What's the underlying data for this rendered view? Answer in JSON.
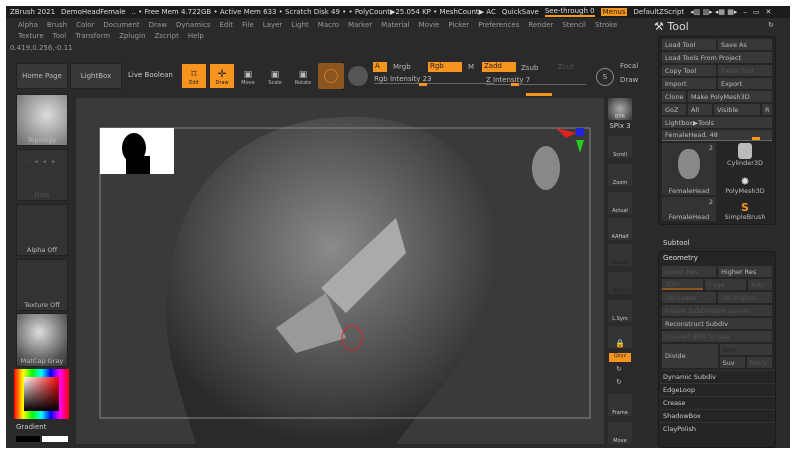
{
  "titlebar": {
    "app": "ZBrush 2021",
    "doc": "DemoHeadFemale",
    "stats": ".. • Free Mem 4.722GB • Active Mem 633 • Scratch Disk 49 • • PolyCount▶25.054 KP • MeshCount▶ AC",
    "quicksave": "QuickSave",
    "seethrough": "See-through  0",
    "menus": "Menus",
    "script": "DefaultZScript"
  },
  "menu": [
    "Alpha",
    "Brush",
    "Color",
    "Document",
    "Draw",
    "Dynamics",
    "Edit",
    "File",
    "Layer",
    "Light",
    "Macro",
    "Marker",
    "Material",
    "Movie",
    "Picker",
    "Preferences",
    "Render",
    "Stencil",
    "Stroke",
    "Texture",
    "Tool",
    "Transform",
    "Zplugin",
    "Zscript",
    "Help"
  ],
  "coords": "0.419,0.256,-0.11",
  "toolbar": {
    "home": "Home Page",
    "lightbox": "LightBox",
    "liveboolean": "Live Boolean",
    "edit": "Edit",
    "draw": "Draw",
    "move": "Move",
    "scale": "Scale",
    "rotate": "Rotate",
    "a": "A",
    "mrgb": "Mrgb",
    "rgb": "Rgb",
    "m": "M",
    "zadd": "Zadd",
    "zsub": "Zsub",
    "zcut": "Zcut",
    "rgb_intensity": "Rgb Intensity 23",
    "z_intensity": "Z Intensity 7",
    "focal": "Focal",
    "draw2": "Draw",
    "rgb_intensity_value": 23,
    "z_intensity_value": 7
  },
  "left": {
    "topology": "Topology",
    "dots": "Dots",
    "alpha": "Alpha Off",
    "texture": "Texture Off",
    "matcap": "MatCap Gray",
    "gradient": "Gradient"
  },
  "rightshelf": {
    "bpr": "BPR",
    "spix": "SPix 3",
    "scroll": "Scroll",
    "zoom": "Zoom",
    "actual": "Actual",
    "aahalf": "AAHalf",
    "persp": "Persp",
    "floor": "Floor",
    "lsym": "L.Sym",
    "frame": "Frame",
    "move": "Move",
    "xyz": "Qxyz"
  },
  "tool": {
    "title": "Tool",
    "load": "Load Tool",
    "saveas": "Save As",
    "loadproj": "Load Tools From Project",
    "copy": "Copy Tool",
    "paste": "Paste Tool",
    "import": "Import",
    "export": "Export",
    "clone": "Clone",
    "make": "Make PolyMesh3D",
    "goz": "GoZ",
    "all": "All",
    "visible": "Visible",
    "r": "R",
    "lightbox": "Lightbox▶Tools",
    "slider": "FemaleHead. 48",
    "slider_value": 48,
    "thumbs": [
      {
        "label": "FemaleHead",
        "count": "2"
      },
      {
        "label": "Cylinder3D"
      },
      {
        "label": "PolyMesh3D"
      },
      {
        "label": "FemaleHead",
        "count": "2"
      },
      {
        "label": "SimpleBrush"
      }
    ],
    "subtool": "Subtool",
    "geometry": "Geometry",
    "lower": "Lower Res",
    "higher": "Higher Res",
    "sdiv": "SDiv",
    "cage": "Cage",
    "rstr": "Rstr",
    "dellower": "Del Lower",
    "delhigher": "Del Higher",
    "freeze": "Freeze SubDivision Levels",
    "reconstruct": "Reconstruct Subdiv",
    "convert": "Convert BPR To Geo",
    "divide": "Divide",
    "smt": "Smt",
    "suv": "Suv",
    "reuv": "ReUV",
    "list": [
      "Dynamic Subdiv",
      "EdgeLoop",
      "Crease",
      "ShadowBox",
      "ClayPolish"
    ]
  },
  "colors": {
    "accent": "#f7941d",
    "bg": "#2a2a2a"
  }
}
